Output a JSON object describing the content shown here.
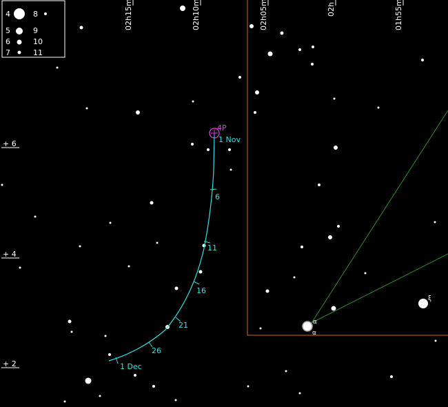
{
  "ra_labels": [
    "02h15m",
    "02h10m",
    "02h05m",
    "02h",
    "01h55m"
  ],
  "dec_labels": [
    "+ 6",
    "+ 4",
    "+ 2"
  ],
  "comet": {
    "name": "4P",
    "start_label": "1 Nov"
  },
  "track_labels": [
    "6",
    "11",
    "16",
    "21",
    "26",
    "1 Dec"
  ],
  "star_labels": [
    "α",
    "α",
    "ξ"
  ],
  "legend": {
    "magnitudes": [
      "4",
      "5",
      "6",
      "7",
      "8",
      "9",
      "10",
      "11"
    ]
  },
  "colors": {
    "background": "#000000",
    "track": "#33e0e0",
    "comet": "#e040e0",
    "boundary": "#d2691e",
    "constellation_line": "#2e8b2e",
    "stars": "#ffffff"
  }
}
